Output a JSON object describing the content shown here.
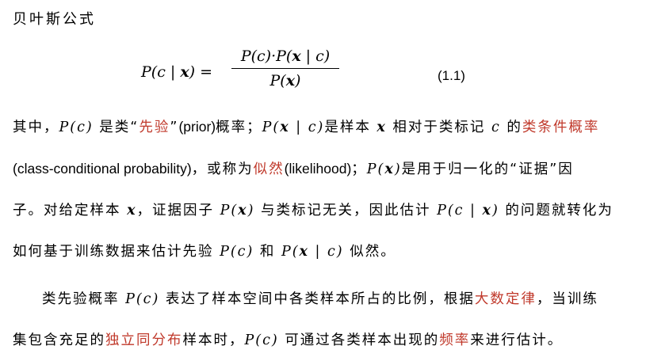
{
  "heading": "贝叶斯公式",
  "equation": {
    "lhs_p": "P(",
    "lhs_c": "c",
    "lhs_bar": " | ",
    "lhs_x": "x",
    "lhs_end": ") =",
    "num_a": "P(c)·P(",
    "num_x": "x",
    "num_b": " | c)",
    "den_a": "P(",
    "den_x": "x",
    "den_b": ")",
    "number": "(1.1)"
  },
  "paragraph1": {
    "l1": [
      "其中，",
      "P(c)",
      " 是类“",
      "先验",
      "”",
      "(prior)",
      "概率；",
      "P(",
      "x",
      " | c)",
      "是样本 ",
      "x",
      " 相对于类标记 ",
      "c",
      " 的",
      "类条件概率"
    ],
    "l2": [
      "(class-conditional probability)",
      "，或称为",
      "似然",
      "(likelihood)",
      "；",
      "P(",
      "x",
      ")",
      "是用于归一化的“证据”因"
    ],
    "l3": [
      "子。对给定样本 ",
      "x",
      "，证据因子 ",
      "P(",
      "x",
      ")",
      " 与类标记无关，因此估计 ",
      "P(c | ",
      "x",
      ")",
      " 的问题就转化为"
    ],
    "l4": [
      "如何基于训练数据来估计先验 ",
      "P(c)",
      " 和 ",
      "P(",
      "x",
      " | c)",
      " 似然。"
    ]
  },
  "paragraph2": {
    "l1": [
      "类先验概率 ",
      "P(c)",
      " 表达了样本空间中各类样本所占的比例，根据",
      "大数定律",
      "，当训练"
    ],
    "l2": [
      "集包含充足的",
      "独立同分布",
      "样本时，",
      "P(c)",
      " 可通过各类样本出现的",
      "频率",
      "来进行估计。"
    ]
  }
}
